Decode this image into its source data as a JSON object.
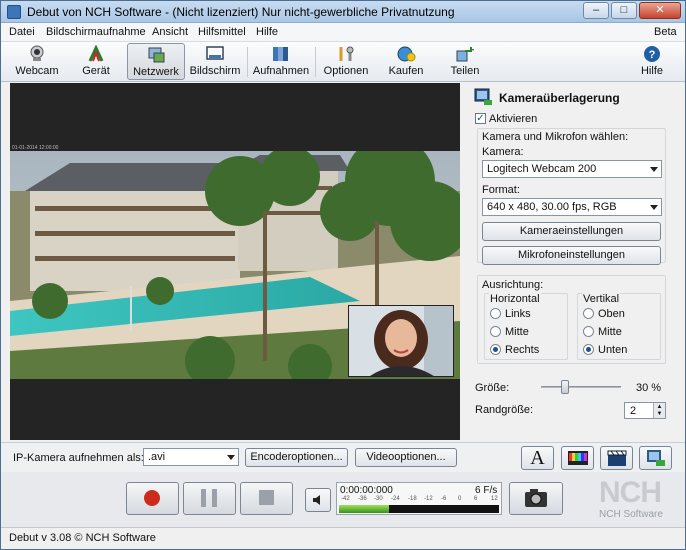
{
  "window": {
    "title": "Debut von NCH Software - (Nicht lizenziert) Nur nicht-gewerbliche Privatnutzung"
  },
  "menu": {
    "items": [
      "Datei",
      "Bildschirmaufnahme",
      "Ansicht",
      "Hilfsmittel",
      "Hilfe"
    ],
    "beta": "Beta"
  },
  "toolbar": {
    "items": [
      {
        "label": "Webcam",
        "icon": "webcam-icon"
      },
      {
        "label": "Gerät",
        "icon": "device-icon"
      },
      {
        "label": "Netzwerk",
        "icon": "network-icon"
      },
      {
        "label": "Bildschirm",
        "icon": "screen-icon"
      },
      {
        "label": "Aufnahmen",
        "icon": "recordings-icon"
      },
      {
        "label": "Optionen",
        "icon": "options-icon"
      },
      {
        "label": "Kaufen",
        "icon": "buy-icon"
      },
      {
        "label": "Teilen",
        "icon": "share-icon"
      },
      {
        "label": "Hilfe",
        "icon": "help-icon"
      }
    ]
  },
  "overlay": {
    "title": "Kameraüberlagerung",
    "enable_label": "Aktivieren",
    "enabled": true,
    "choose_label": "Kamera und Mikrofon wählen:",
    "camera_label": "Kamera:",
    "camera_value": "Logitech Webcam 200",
    "format_label": "Format:",
    "format_value": "640 x 480, 30.00 fps, RGB",
    "camera_settings_btn": "Kameraeinstellungen",
    "mic_settings_btn": "Mikrofoneinstellungen",
    "alignment_label": "Ausrichtung:",
    "horizontal_label": "Horizontal",
    "horizontal_options": [
      "Links",
      "Mitte",
      "Rechts"
    ],
    "horizontal_selected": "Rechts",
    "vertical_label": "Vertikal",
    "vertical_options": [
      "Oben",
      "Mitte",
      "Unten"
    ],
    "vertical_selected": "Unten",
    "size_label": "Größe:",
    "size_value": "30 %",
    "size_fraction": 0.3,
    "border_label": "Randgröße:",
    "border_value": "2"
  },
  "record": {
    "label": "IP-Kamera aufnehmen als:",
    "format_value": ".avi",
    "encoder_btn": "Encoderoptionen...",
    "video_btn": "Videooptionen..."
  },
  "transport": {
    "time": "0:00:00:000",
    "fps": "6 F/s",
    "meter_ticks": [
      "-42",
      "-36",
      "-30",
      "-24",
      "-18",
      "-12",
      "-6",
      "0",
      "6",
      "12"
    ]
  },
  "brand": {
    "logo": "NCH",
    "sub": "NCH Software"
  },
  "status": {
    "text": "Debut v 3.08 © NCH Software"
  },
  "preview": {
    "timestamp": "01-01-2014 12:00:00"
  },
  "colors": {
    "accent": "#1d4f91",
    "record": "#cc2a1d",
    "meter": "#52b62a",
    "title_bar": "#b8d0ea"
  }
}
